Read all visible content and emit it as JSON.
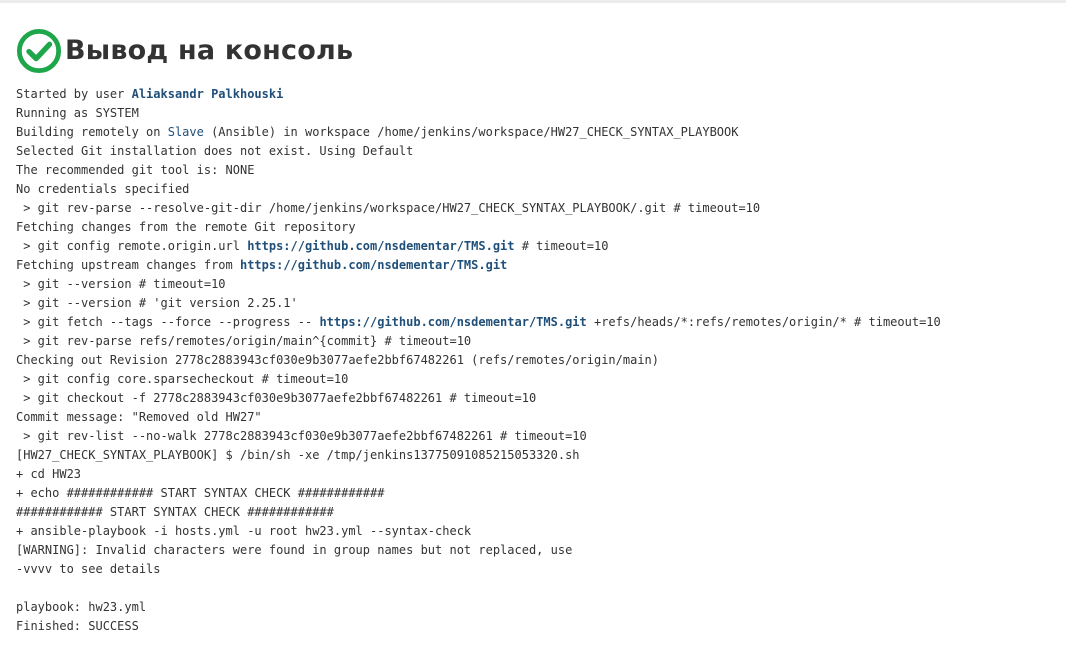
{
  "header": {
    "title": "Вывод на консоль",
    "status_icon": "check-circle-icon",
    "status_color": "#1ea64b"
  },
  "colors": {
    "text": "#333333",
    "link": "#20507a",
    "title": "#333333"
  },
  "console": {
    "lines": [
      [
        {
          "t": "Started by user "
        },
        {
          "t": "Aliaksandr Palkhouski",
          "k": "link-bold",
          "n": "user-link"
        }
      ],
      [
        {
          "t": "Running as SYSTEM"
        }
      ],
      [
        {
          "t": "Building remotely on "
        },
        {
          "t": "Slave",
          "k": "link",
          "n": "node-link"
        },
        {
          "t": " (Ansible) in workspace /home/jenkins/workspace/HW27_CHECK_SYNTAX_PLAYBOOK"
        }
      ],
      [
        {
          "t": "Selected Git installation does not exist. Using Default"
        }
      ],
      [
        {
          "t": "The recommended git tool is: NONE"
        }
      ],
      [
        {
          "t": "No credentials specified"
        }
      ],
      [
        {
          "t": " > git rev-parse --resolve-git-dir /home/jenkins/workspace/HW27_CHECK_SYNTAX_PLAYBOOK/.git # timeout=10"
        }
      ],
      [
        {
          "t": "Fetching changes from the remote Git repository"
        }
      ],
      [
        {
          "t": " > git config remote.origin.url "
        },
        {
          "t": "https://github.com/nsdementar/TMS.git",
          "k": "link-bold",
          "n": "repo-link"
        },
        {
          "t": " # timeout=10"
        }
      ],
      [
        {
          "t": "Fetching upstream changes from "
        },
        {
          "t": "https://github.com/nsdementar/TMS.git",
          "k": "link-bold",
          "n": "repo-link"
        }
      ],
      [
        {
          "t": " > git --version # timeout=10"
        }
      ],
      [
        {
          "t": " > git --version # 'git version 2.25.1'"
        }
      ],
      [
        {
          "t": " > git fetch --tags --force --progress -- "
        },
        {
          "t": "https://github.com/nsdementar/TMS.git",
          "k": "link-bold",
          "n": "repo-link"
        },
        {
          "t": " +refs/heads/*:refs/remotes/origin/* # timeout=10"
        }
      ],
      [
        {
          "t": " > git rev-parse refs/remotes/origin/main^{commit} # timeout=10"
        }
      ],
      [
        {
          "t": "Checking out Revision 2778c2883943cf030e9b3077aefe2bbf67482261 (refs/remotes/origin/main)"
        }
      ],
      [
        {
          "t": " > git config core.sparsecheckout # timeout=10"
        }
      ],
      [
        {
          "t": " > git checkout -f 2778c2883943cf030e9b3077aefe2bbf67482261 # timeout=10"
        }
      ],
      [
        {
          "t": "Commit message: \"Removed old HW27\""
        }
      ],
      [
        {
          "t": " > git rev-list --no-walk 2778c2883943cf030e9b3077aefe2bbf67482261 # timeout=10"
        }
      ],
      [
        {
          "t": "[HW27_CHECK_SYNTAX_PLAYBOOK] $ /bin/sh -xe /tmp/jenkins13775091085215053320.sh"
        }
      ],
      [
        {
          "t": "+ cd HW23"
        }
      ],
      [
        {
          "t": "+ echo ############ START SYNTAX CHECK ############"
        }
      ],
      [
        {
          "t": "############ START SYNTAX CHECK ############"
        }
      ],
      [
        {
          "t": "+ ansible-playbook -i hosts.yml -u root hw23.yml --syntax-check"
        }
      ],
      [
        {
          "t": "[WARNING]: Invalid characters were found in group names but not replaced, use"
        }
      ],
      [
        {
          "t": "-vvvv to see details"
        }
      ],
      [
        {
          "t": ""
        }
      ],
      [
        {
          "t": "playbook: hw23.yml"
        }
      ],
      [
        {
          "t": "Finished: SUCCESS"
        }
      ]
    ]
  }
}
